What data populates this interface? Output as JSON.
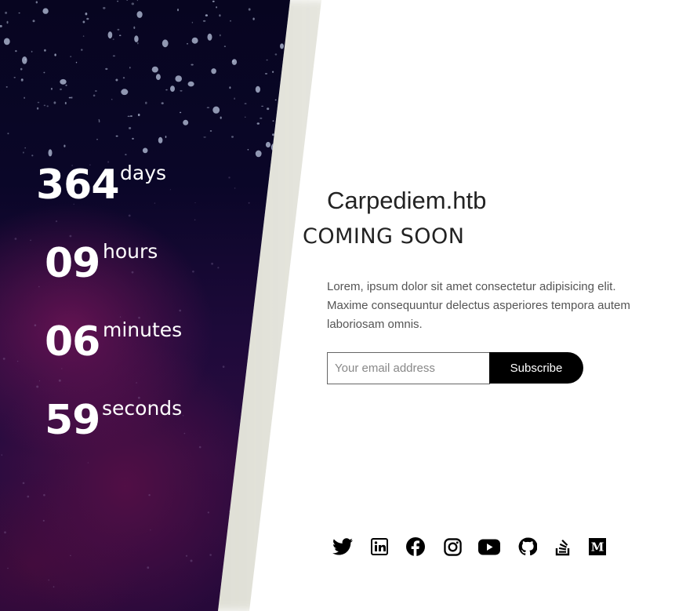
{
  "countdown": {
    "days": {
      "value": "364",
      "unit": "days"
    },
    "hours": {
      "value": "09",
      "unit": "hours"
    },
    "minutes": {
      "value": "06",
      "unit": "minutes"
    },
    "seconds": {
      "value": "59",
      "unit": "seconds"
    }
  },
  "main": {
    "title": "Carpediem.htb",
    "subtitle": "COMING SOON",
    "description": "Lorem, ipsum dolor sit amet consectetur adipisicing elit. Maxime consequuntur delectus asperiores tempora autem laboriosam omnis.",
    "email_placeholder": "Your email address",
    "subscribe_label": "Subscribe"
  },
  "social": [
    "twitter-icon",
    "linkedin-icon",
    "facebook-icon",
    "instagram-icon",
    "youtube-icon",
    "github-icon",
    "stackoverflow-icon",
    "medium-icon"
  ],
  "colors": {
    "panel_dark": "#070520",
    "panel_purple": "#2c0c40",
    "button": "#000000",
    "text": "#222222"
  }
}
